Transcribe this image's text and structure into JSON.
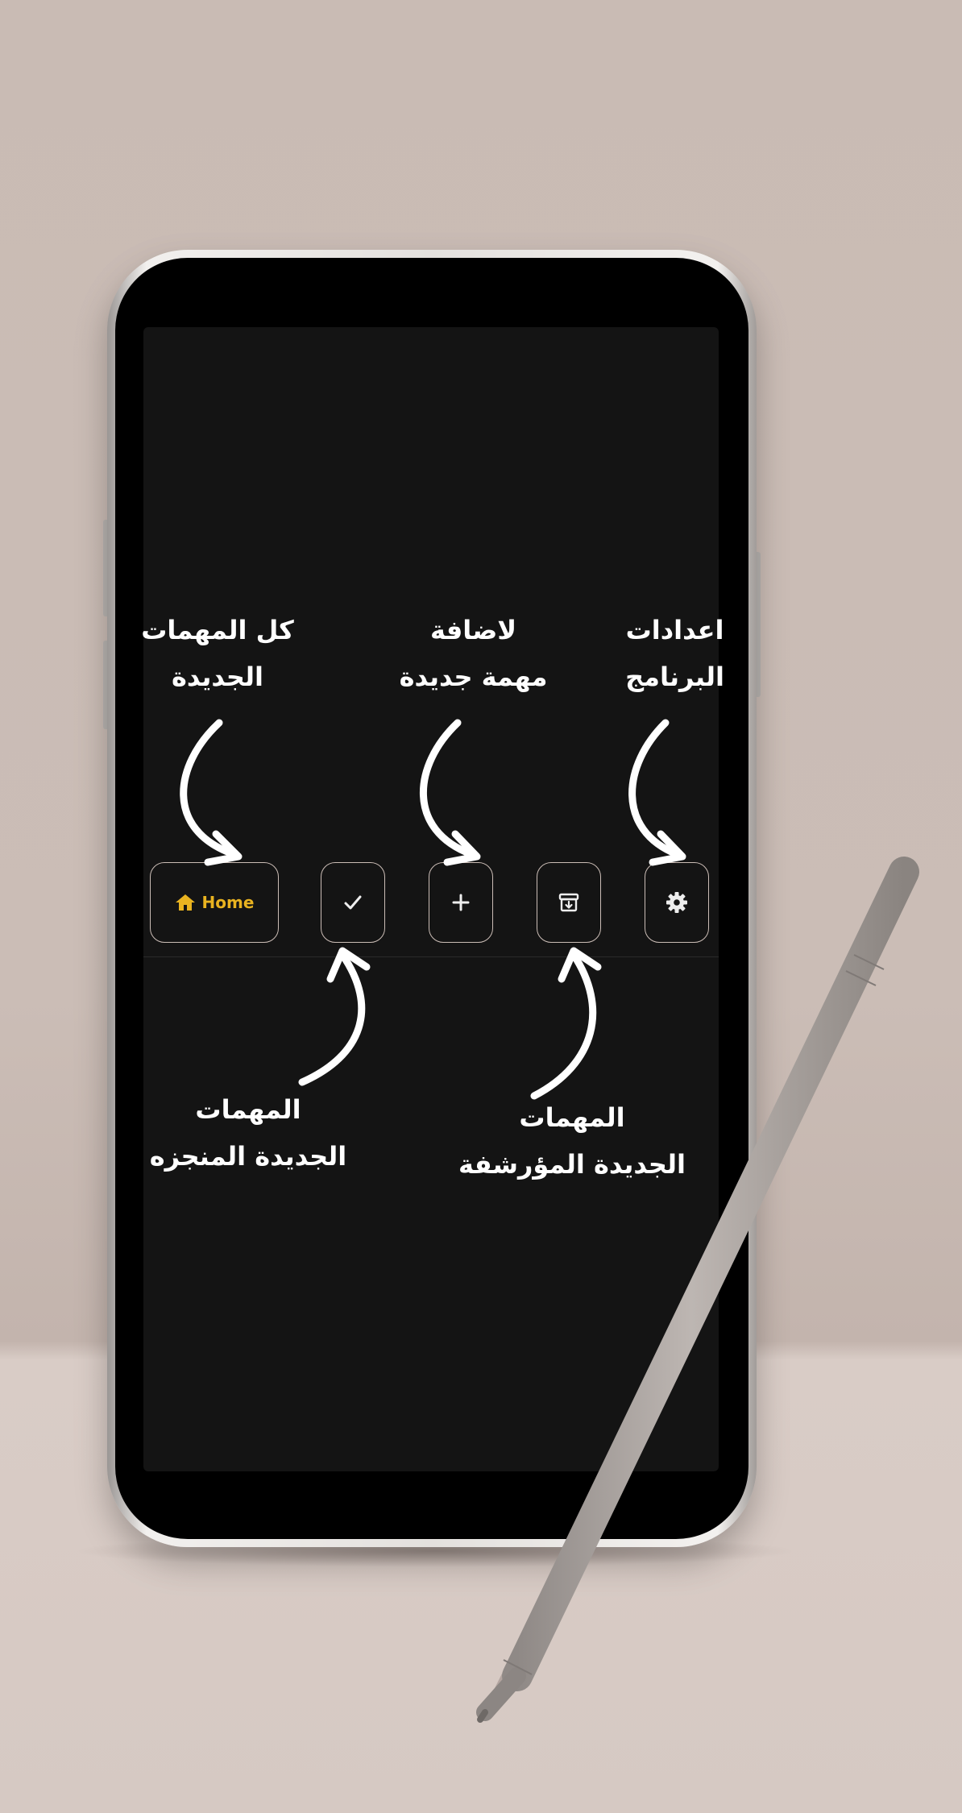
{
  "nav": {
    "home_label": "Home",
    "items": [
      {
        "id": "home",
        "icon": "home-icon",
        "label": "Home"
      },
      {
        "id": "done",
        "icon": "check-icon"
      },
      {
        "id": "add",
        "icon": "plus-icon"
      },
      {
        "id": "archive",
        "icon": "archive-icon"
      },
      {
        "id": "settings",
        "icon": "gear-icon"
      }
    ]
  },
  "annotations": {
    "home_line1": "كل المهمات",
    "home_line2": "الجديدة",
    "add_line1": "لاضافة",
    "add_line2": "مهمة جديدة",
    "settings_line1": "اعدادات",
    "settings_line2": "البرنامج",
    "done_line1": "المهمات",
    "done_line2": "الجديدة المنجزه",
    "archive_line1": "المهمات",
    "archive_line2": "الجديدة المؤرشفة"
  },
  "colors": {
    "accent": "#e9b320",
    "screen": "#141414",
    "button_border": "#cbbdb6",
    "background": "#c9bbb4"
  }
}
